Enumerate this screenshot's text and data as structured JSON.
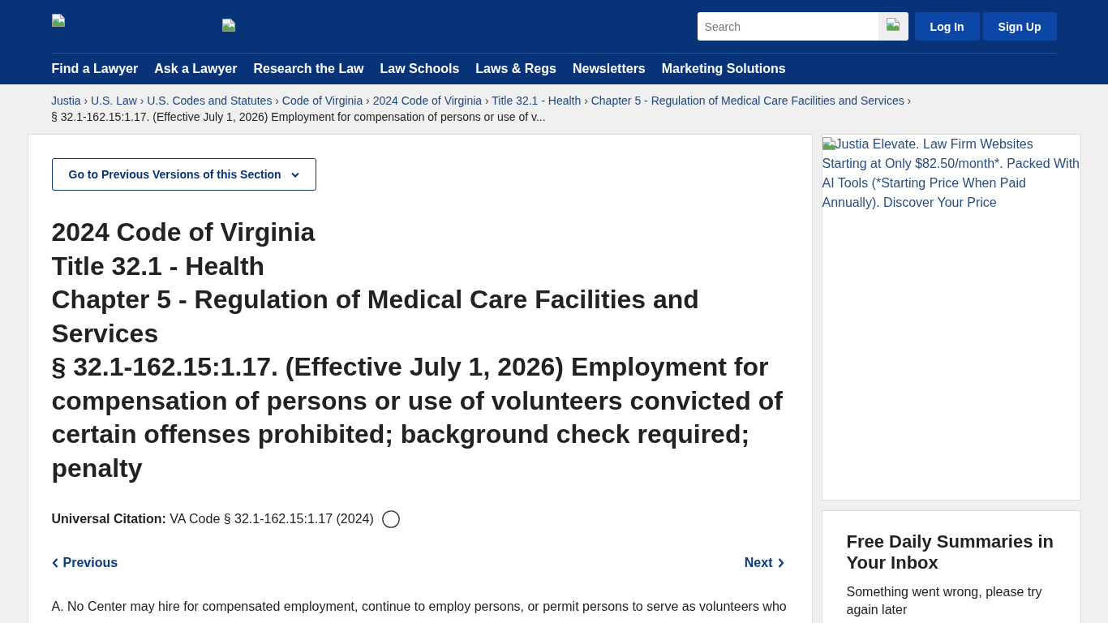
{
  "header": {
    "search": {
      "placeholder": "Search"
    },
    "account_buttons": [
      "Log In",
      "Sign Up"
    ],
    "nav": [
      "Find a Lawyer",
      "Ask a Lawyer",
      "Research the Law",
      "Law Schools",
      "Laws & Regs",
      "Newsletters",
      "Marketing Solutions"
    ]
  },
  "breadcrumb": {
    "links": [
      {
        "label": "Justia",
        "separator": "›"
      },
      {
        "label": "U.S. Law",
        "separator": "›"
      },
      {
        "label": "U.S. Codes and Statutes",
        "separator": "›"
      },
      {
        "label": "Code of Virginia",
        "separator": "›"
      },
      {
        "label": "2024 Code of Virginia",
        "separator": "›"
      },
      {
        "label": "Title 32.1 - Health",
        "separator": "›"
      },
      {
        "label": "Chapter 5 - Regulation of Medical Care Facilities and Services",
        "separator": "›"
      }
    ],
    "current": "§ 32.1-162.15:1.17. (Effective July 1, 2026) Employment for compensation of persons or use of v..."
  },
  "content": {
    "versions_button": "Go to Previous Versions of this Section",
    "headings": [
      "2024 Code of Virginia",
      "Title 32.1 - Health",
      "Chapter 5 - Regulation of Medical Care Facilities and Services",
      "§ 32.1-162.15:1.17. (Effective July 1, 2026) Employment for compensation of persons or use of volunteers convicted of certain offenses prohibited; background check required; penalty"
    ],
    "citation": "**Universal Citation:** VA Code § 32.1-162.15:1.17 (2024)",
    "pager": {
      "previous": "Previous",
      "next": "Next"
    },
    "paragraphs": [
      "A. No Center may hire for compensated employment, continue to employ persons, or permit persons to serve as volunteers who"
    ]
  },
  "sidebar": {
    "ad_alt_text": "Justia Elevate. Law Firm Websites Starting at Only $82.50/month*. Packed With AI Tools (*Starting Price When Paid Annually). Discover Your Price",
    "newsletter": {
      "title": "Free Daily Summaries in Your Inbox",
      "message": "Something went wrong, please try again later"
    }
  }
}
